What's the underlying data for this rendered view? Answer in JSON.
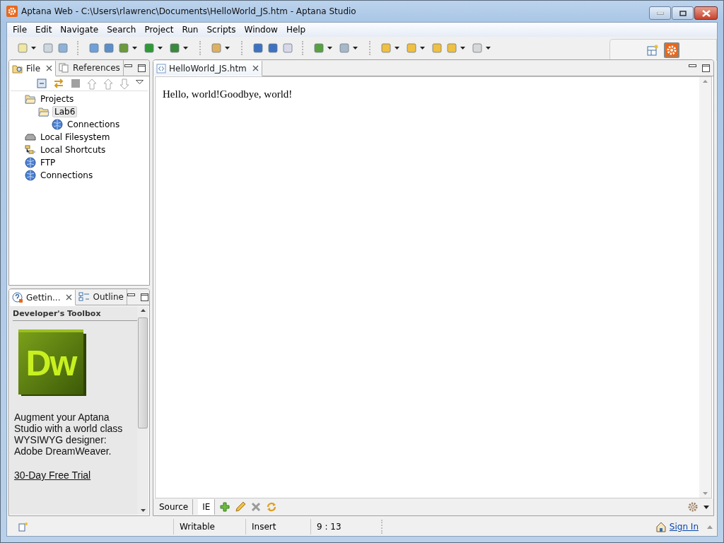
{
  "window": {
    "title": "Aptana Web - C:\\Users\\rlawrenc\\Documents\\HelloWorld_JS.htm - Aptana Studio"
  },
  "menu": [
    "File",
    "Edit",
    "Navigate",
    "Search",
    "Project",
    "Run",
    "Scripts",
    "Window",
    "Help"
  ],
  "file_panel": {
    "tabs": [
      {
        "label": "File",
        "selected": true
      },
      {
        "label": "References",
        "selected": false
      }
    ],
    "tree": [
      {
        "label": "Projects",
        "kind": "folder",
        "selected": false,
        "children": [
          {
            "label": "Lab6",
            "kind": "folder",
            "selected": true,
            "children": [
              {
                "label": "Connections",
                "kind": "globe",
                "selected": false
              }
            ]
          }
        ]
      },
      {
        "label": "Local Filesystem",
        "kind": "drive",
        "selected": false
      },
      {
        "label": "Local Shortcuts",
        "kind": "shortcuts",
        "selected": false
      },
      {
        "label": "FTP",
        "kind": "globe",
        "selected": false
      },
      {
        "label": "Connections",
        "kind": "globe",
        "selected": false
      }
    ]
  },
  "help_panel": {
    "tabs": [
      {
        "label": "Gettin...",
        "selected": true
      },
      {
        "label": "Outline",
        "selected": false
      }
    ],
    "heading": "Developer's Toolbox",
    "logo_text": "Dw",
    "description": "Augment your Aptana Studio with a world class WYSIWYG designer: Adobe DreamWeaver.",
    "link": "30-Day Free Trial"
  },
  "editor": {
    "tabs": [
      {
        "label": "HelloWorld_JS.htm",
        "selected": true
      }
    ],
    "content": "Hello, world!Goodbye, world!",
    "bottom_tabs": [
      {
        "label": "Source",
        "selected": false
      },
      {
        "label": "IE",
        "selected": true
      }
    ]
  },
  "status_bar": {
    "mode": "Writable",
    "insert_mode": "Insert",
    "position": "9 : 13",
    "sign_in": "Sign In"
  }
}
